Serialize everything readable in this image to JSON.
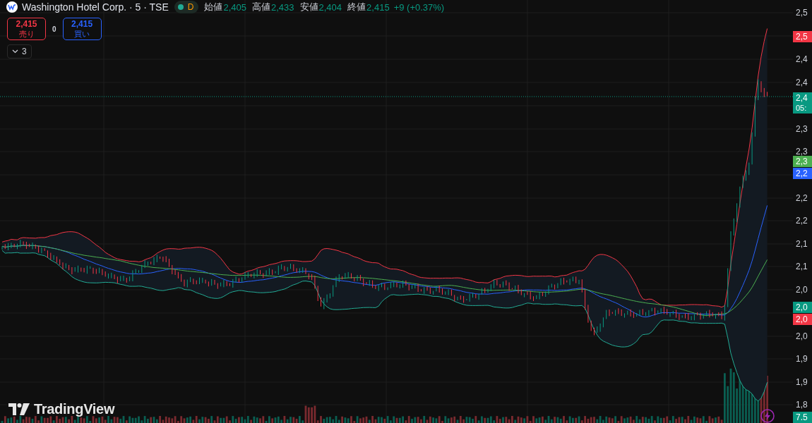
{
  "header": {
    "symbol": "Washington Hotel Corp. · 5 · TSE",
    "market_open": true,
    "interval_badge": "D",
    "ohlc": [
      {
        "label": "始値",
        "value": "2,405"
      },
      {
        "label": "高値",
        "value": "2,433"
      },
      {
        "label": "安値",
        "value": "2,404"
      },
      {
        "label": "終値",
        "value": "2,415"
      }
    ],
    "change": "+9 (+0.37%)"
  },
  "order": {
    "sell": {
      "price": "2,415",
      "label": "売り"
    },
    "spread": "0",
    "buy": {
      "price": "2,415",
      "label": "買い"
    }
  },
  "indicators_toggle": {
    "count": "3",
    "expanded": false
  },
  "price_axis": {
    "ticks": [
      "2,5",
      "2,4",
      "2,4",
      "2,3",
      "2,3",
      "2,2",
      "2,2",
      "2,1",
      "2,1",
      "2,0",
      "2,0",
      "1,9",
      "1,9",
      "1,8"
    ],
    "badges": [
      {
        "text": "2,5",
        "color": "#f23645"
      },
      {
        "text": "2,4",
        "subtext": "05:",
        "color": "#089981"
      },
      {
        "text": "2,3",
        "color": "#4caf50"
      },
      {
        "text": "2,2",
        "color": "#2962ff"
      },
      {
        "text": "2,0",
        "color": "#089981"
      },
      {
        "text": "2,0",
        "color": "#f23645"
      },
      {
        "text": "7.5",
        "color": "#089981"
      }
    ]
  },
  "branding": "TradingView"
}
